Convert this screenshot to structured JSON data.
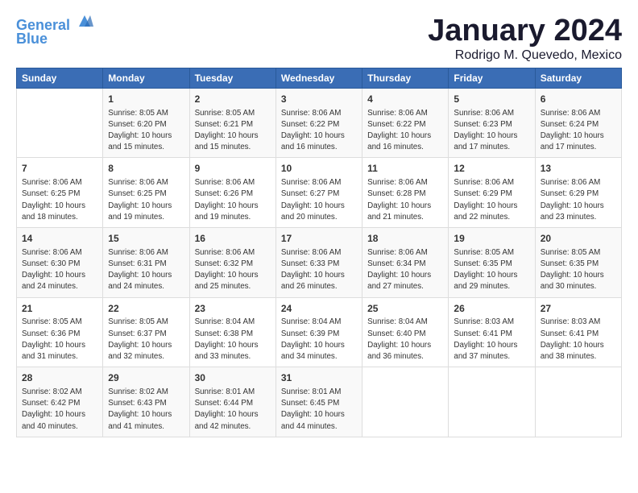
{
  "logo": {
    "line1": "General",
    "line2": "Blue"
  },
  "title": "January 2024",
  "subtitle": "Rodrigo M. Quevedo, Mexico",
  "days_header": [
    "Sunday",
    "Monday",
    "Tuesday",
    "Wednesday",
    "Thursday",
    "Friday",
    "Saturday"
  ],
  "weeks": [
    [
      {
        "num": "",
        "detail": ""
      },
      {
        "num": "1",
        "detail": "Sunrise: 8:05 AM\nSunset: 6:20 PM\nDaylight: 10 hours\nand 15 minutes."
      },
      {
        "num": "2",
        "detail": "Sunrise: 8:05 AM\nSunset: 6:21 PM\nDaylight: 10 hours\nand 15 minutes."
      },
      {
        "num": "3",
        "detail": "Sunrise: 8:06 AM\nSunset: 6:22 PM\nDaylight: 10 hours\nand 16 minutes."
      },
      {
        "num": "4",
        "detail": "Sunrise: 8:06 AM\nSunset: 6:22 PM\nDaylight: 10 hours\nand 16 minutes."
      },
      {
        "num": "5",
        "detail": "Sunrise: 8:06 AM\nSunset: 6:23 PM\nDaylight: 10 hours\nand 17 minutes."
      },
      {
        "num": "6",
        "detail": "Sunrise: 8:06 AM\nSunset: 6:24 PM\nDaylight: 10 hours\nand 17 minutes."
      }
    ],
    [
      {
        "num": "7",
        "detail": "Sunrise: 8:06 AM\nSunset: 6:25 PM\nDaylight: 10 hours\nand 18 minutes."
      },
      {
        "num": "8",
        "detail": "Sunrise: 8:06 AM\nSunset: 6:25 PM\nDaylight: 10 hours\nand 19 minutes."
      },
      {
        "num": "9",
        "detail": "Sunrise: 8:06 AM\nSunset: 6:26 PM\nDaylight: 10 hours\nand 19 minutes."
      },
      {
        "num": "10",
        "detail": "Sunrise: 8:06 AM\nSunset: 6:27 PM\nDaylight: 10 hours\nand 20 minutes."
      },
      {
        "num": "11",
        "detail": "Sunrise: 8:06 AM\nSunset: 6:28 PM\nDaylight: 10 hours\nand 21 minutes."
      },
      {
        "num": "12",
        "detail": "Sunrise: 8:06 AM\nSunset: 6:29 PM\nDaylight: 10 hours\nand 22 minutes."
      },
      {
        "num": "13",
        "detail": "Sunrise: 8:06 AM\nSunset: 6:29 PM\nDaylight: 10 hours\nand 23 minutes."
      }
    ],
    [
      {
        "num": "14",
        "detail": "Sunrise: 8:06 AM\nSunset: 6:30 PM\nDaylight: 10 hours\nand 24 minutes."
      },
      {
        "num": "15",
        "detail": "Sunrise: 8:06 AM\nSunset: 6:31 PM\nDaylight: 10 hours\nand 24 minutes."
      },
      {
        "num": "16",
        "detail": "Sunrise: 8:06 AM\nSunset: 6:32 PM\nDaylight: 10 hours\nand 25 minutes."
      },
      {
        "num": "17",
        "detail": "Sunrise: 8:06 AM\nSunset: 6:33 PM\nDaylight: 10 hours\nand 26 minutes."
      },
      {
        "num": "18",
        "detail": "Sunrise: 8:06 AM\nSunset: 6:34 PM\nDaylight: 10 hours\nand 27 minutes."
      },
      {
        "num": "19",
        "detail": "Sunrise: 8:05 AM\nSunset: 6:35 PM\nDaylight: 10 hours\nand 29 minutes."
      },
      {
        "num": "20",
        "detail": "Sunrise: 8:05 AM\nSunset: 6:35 PM\nDaylight: 10 hours\nand 30 minutes."
      }
    ],
    [
      {
        "num": "21",
        "detail": "Sunrise: 8:05 AM\nSunset: 6:36 PM\nDaylight: 10 hours\nand 31 minutes."
      },
      {
        "num": "22",
        "detail": "Sunrise: 8:05 AM\nSunset: 6:37 PM\nDaylight: 10 hours\nand 32 minutes."
      },
      {
        "num": "23",
        "detail": "Sunrise: 8:04 AM\nSunset: 6:38 PM\nDaylight: 10 hours\nand 33 minutes."
      },
      {
        "num": "24",
        "detail": "Sunrise: 8:04 AM\nSunset: 6:39 PM\nDaylight: 10 hours\nand 34 minutes."
      },
      {
        "num": "25",
        "detail": "Sunrise: 8:04 AM\nSunset: 6:40 PM\nDaylight: 10 hours\nand 36 minutes."
      },
      {
        "num": "26",
        "detail": "Sunrise: 8:03 AM\nSunset: 6:41 PM\nDaylight: 10 hours\nand 37 minutes."
      },
      {
        "num": "27",
        "detail": "Sunrise: 8:03 AM\nSunset: 6:41 PM\nDaylight: 10 hours\nand 38 minutes."
      }
    ],
    [
      {
        "num": "28",
        "detail": "Sunrise: 8:02 AM\nSunset: 6:42 PM\nDaylight: 10 hours\nand 40 minutes."
      },
      {
        "num": "29",
        "detail": "Sunrise: 8:02 AM\nSunset: 6:43 PM\nDaylight: 10 hours\nand 41 minutes."
      },
      {
        "num": "30",
        "detail": "Sunrise: 8:01 AM\nSunset: 6:44 PM\nDaylight: 10 hours\nand 42 minutes."
      },
      {
        "num": "31",
        "detail": "Sunrise: 8:01 AM\nSunset: 6:45 PM\nDaylight: 10 hours\nand 44 minutes."
      },
      {
        "num": "",
        "detail": ""
      },
      {
        "num": "",
        "detail": ""
      },
      {
        "num": "",
        "detail": ""
      }
    ]
  ]
}
